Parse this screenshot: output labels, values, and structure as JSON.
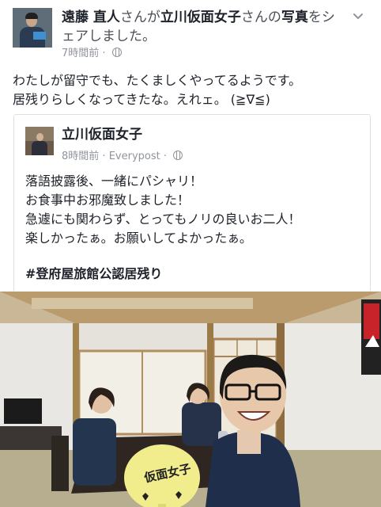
{
  "post": {
    "author": "遠藤 直人",
    "san1": "さんが",
    "target": "立川仮面女子",
    "san2": "さんの",
    "object": "写真",
    "action_a": "をシ",
    "action_b": "ェアしました。",
    "time": "7時間前",
    "separator": "·",
    "icons": {
      "chevron": "chevron-down-icon",
      "globe": "globe-icon"
    },
    "text_line1": "わたしが留守でも、たくましくやってるようです。",
    "text_line2": "居残りらしくなってきたな。えれェ。 (≧∇≦)"
  },
  "shared": {
    "name": "立川仮面女子",
    "time": "8時間前",
    "via": "Everypost",
    "line1": "落語披露後、一緒にパシャリ！",
    "line2": "お食事中お邪魔致しました！",
    "line3": "急遽にも関わらず、とってもノリの良いお二人！",
    "line4": "楽しかったぁ。お願いしてよかったぁ。",
    "hashtag": "#登府屋旅館公認居残り"
  },
  "photo": {
    "fan_text": "仮面女子"
  }
}
